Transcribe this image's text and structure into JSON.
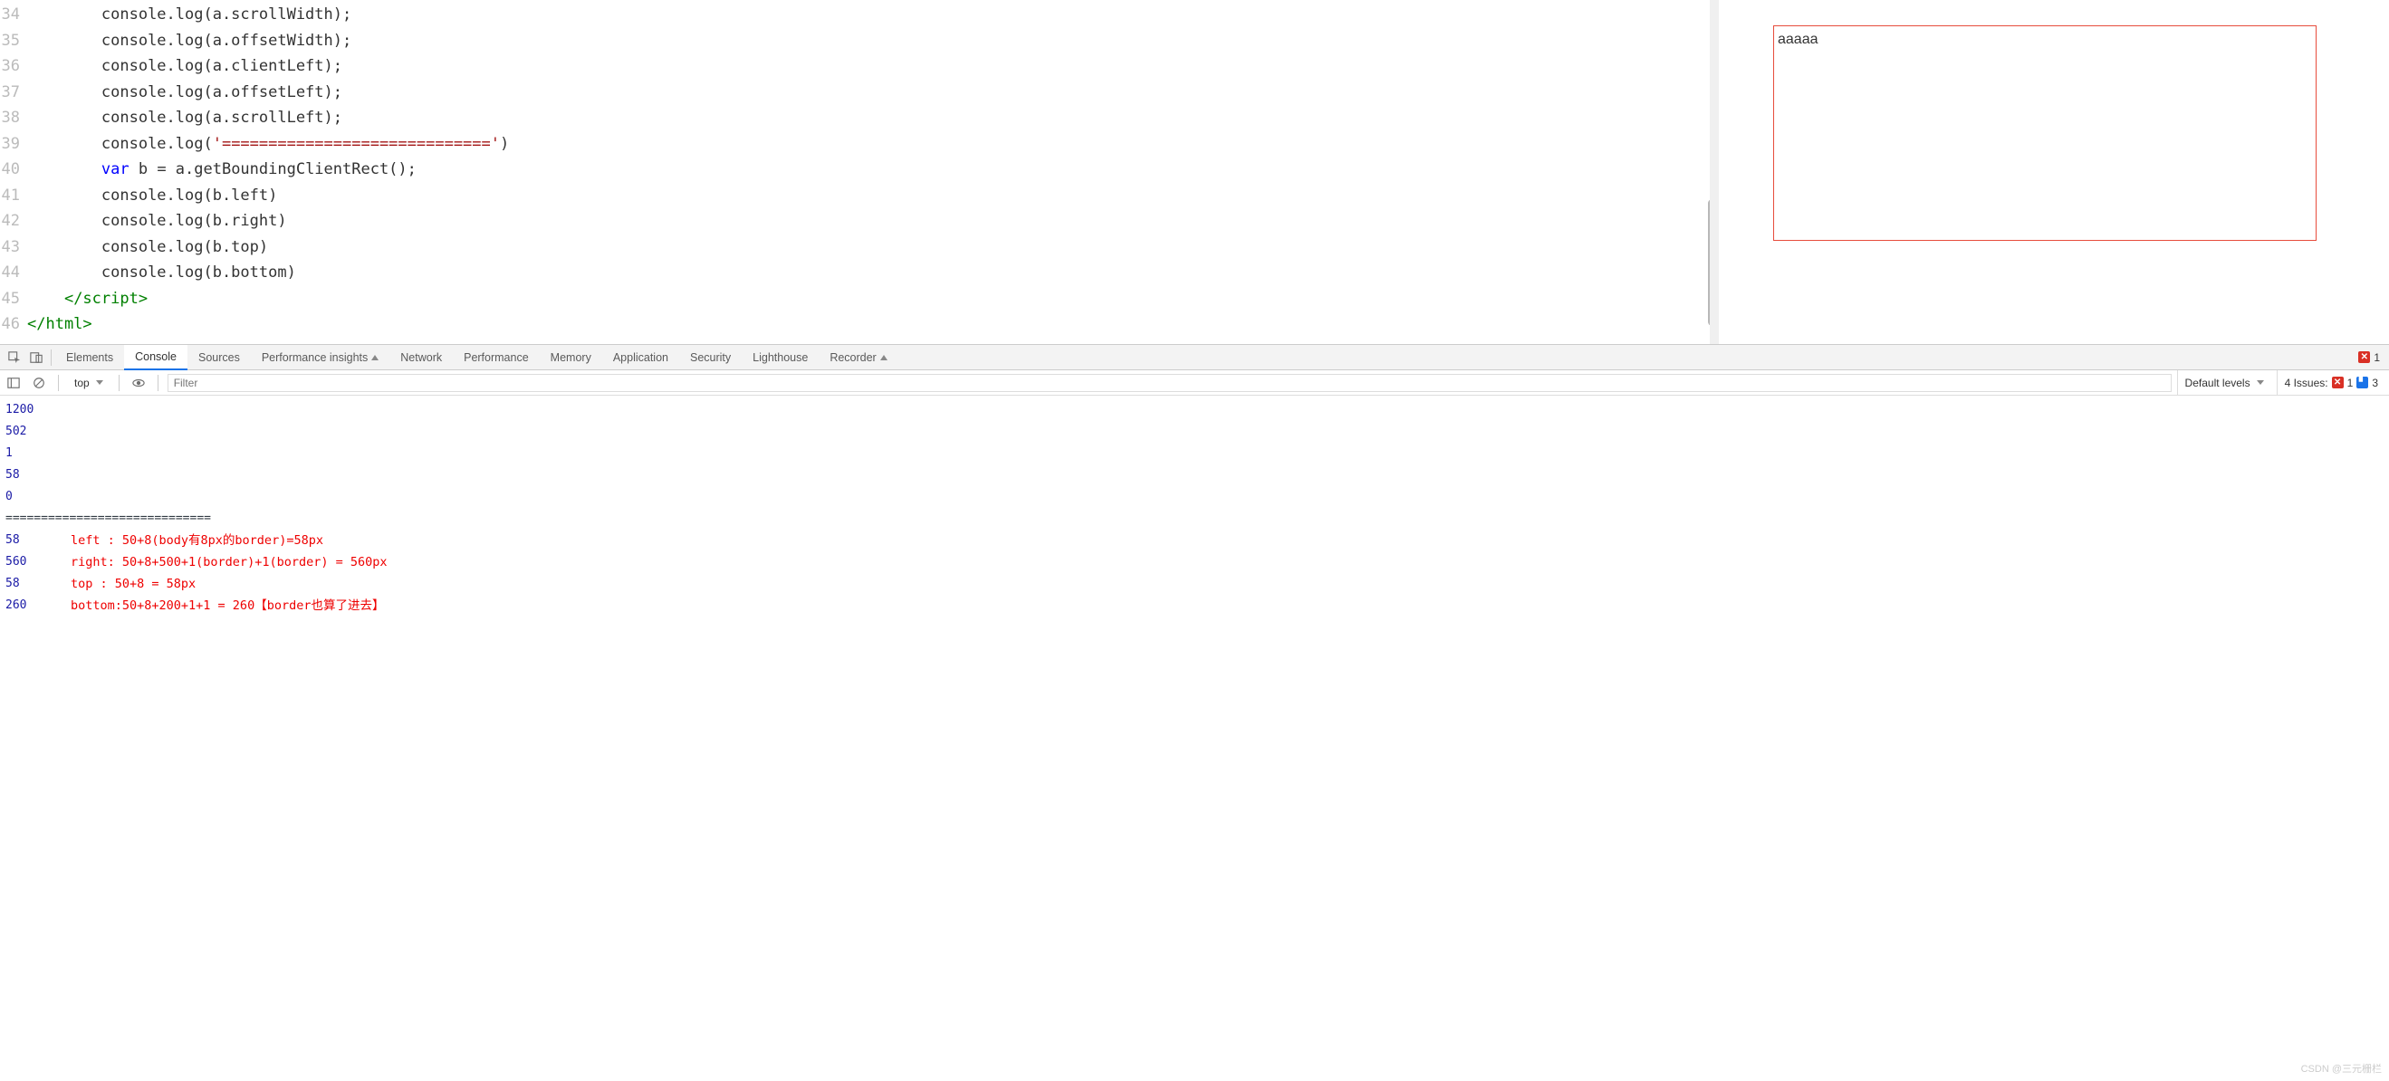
{
  "code": {
    "lines": [
      {
        "n": 34,
        "indent": "        ",
        "tokens": [
          {
            "t": "console.log(a.scrollWidth);",
            "c": ""
          }
        ]
      },
      {
        "n": 35,
        "indent": "        ",
        "tokens": [
          {
            "t": "console.log(a.offsetWidth);",
            "c": ""
          }
        ]
      },
      {
        "n": 36,
        "indent": "        ",
        "tokens": [
          {
            "t": "console.log(a.clientLeft);",
            "c": ""
          }
        ]
      },
      {
        "n": 37,
        "indent": "        ",
        "tokens": [
          {
            "t": "console.log(a.offsetLeft);",
            "c": ""
          }
        ]
      },
      {
        "n": 38,
        "indent": "        ",
        "tokens": [
          {
            "t": "console.log(a.scrollLeft);",
            "c": ""
          }
        ]
      },
      {
        "n": 39,
        "indent": "        ",
        "tokens": [
          {
            "t": "console.log(",
            "c": ""
          },
          {
            "t": "'============================='",
            "c": "str"
          },
          {
            "t": ")",
            "c": ""
          }
        ]
      },
      {
        "n": 40,
        "indent": "        ",
        "tokens": [
          {
            "t": "var",
            "c": "kw"
          },
          {
            "t": " b = a.getBoundingClientRect();",
            "c": ""
          }
        ]
      },
      {
        "n": 41,
        "indent": "        ",
        "tokens": [
          {
            "t": "console.log(b.left)",
            "c": ""
          }
        ]
      },
      {
        "n": 42,
        "indent": "        ",
        "tokens": [
          {
            "t": "console.log(b.right)",
            "c": ""
          }
        ]
      },
      {
        "n": 43,
        "indent": "        ",
        "tokens": [
          {
            "t": "console.log(b.top)",
            "c": ""
          }
        ]
      },
      {
        "n": 44,
        "indent": "        ",
        "tokens": [
          {
            "t": "console.log(b.bottom)",
            "c": ""
          }
        ]
      },
      {
        "n": 45,
        "indent": "    ",
        "tokens": [
          {
            "t": "</script",
            "c": "tg"
          },
          {
            "t": ">",
            "c": "tg"
          }
        ]
      },
      {
        "n": 46,
        "indent": "",
        "tokens": [
          {
            "t": "</html>",
            "c": "tg"
          }
        ]
      }
    ]
  },
  "preview": {
    "box_text": "aaaaa"
  },
  "devtools": {
    "tabs": [
      "Elements",
      "Console",
      "Sources",
      "Performance insights",
      "Network",
      "Performance",
      "Memory",
      "Application",
      "Security",
      "Lighthouse",
      "Recorder"
    ],
    "active_tab": "Console",
    "experiment_tabs": [
      "Performance insights",
      "Recorder"
    ],
    "error_count": "1"
  },
  "console_toolbar": {
    "context": "top",
    "filter_placeholder": "Filter",
    "levels": "Default levels",
    "issues_label": "4 Issues:",
    "issues_err": "1",
    "issues_info": "3"
  },
  "console_output": {
    "rows": [
      {
        "val": "1200",
        "type": "num"
      },
      {
        "val": "502",
        "type": "num"
      },
      {
        "val": "1",
        "type": "num"
      },
      {
        "val": "58",
        "type": "num"
      },
      {
        "val": "0",
        "type": "num"
      },
      {
        "val": "=============================",
        "type": "str"
      },
      {
        "val": "58",
        "type": "num",
        "annot": "left : 50+8(body有8px的border)=58px"
      },
      {
        "val": "560",
        "type": "num",
        "annot": "right:  50+8+500+1(border)+1(border) = 560px"
      },
      {
        "val": "58",
        "type": "num",
        "annot": "top : 50+8 = 58px"
      },
      {
        "val": "260",
        "type": "num",
        "annot": "bottom:50+8+200+1+1 = 260【border也算了进去】"
      }
    ]
  },
  "watermark": "CSDN @三元栅栏"
}
